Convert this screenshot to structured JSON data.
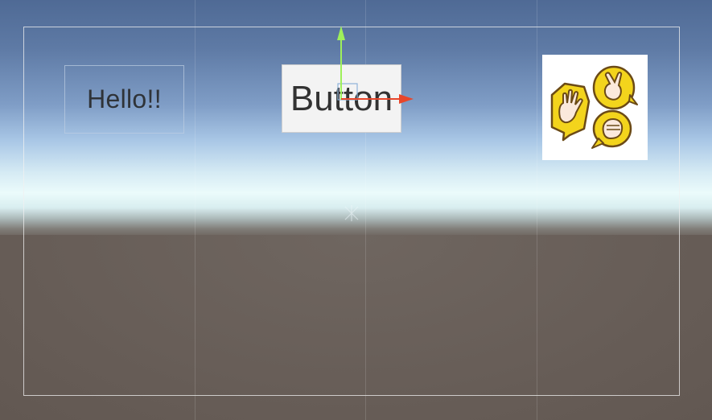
{
  "scene": {
    "sky_colors": [
      "#4f6a95",
      "#ebfbfb"
    ],
    "ground_color": "#6b615b"
  },
  "canvas": {
    "text_element": {
      "text": "Hello!!"
    },
    "button_element": {
      "label": "Button"
    },
    "image_element": {
      "icon": "rock-paper-scissors-icon"
    }
  },
  "gizmo": {
    "x_axis_color": "#e8462a",
    "y_axis_color": "#9ef05a"
  }
}
